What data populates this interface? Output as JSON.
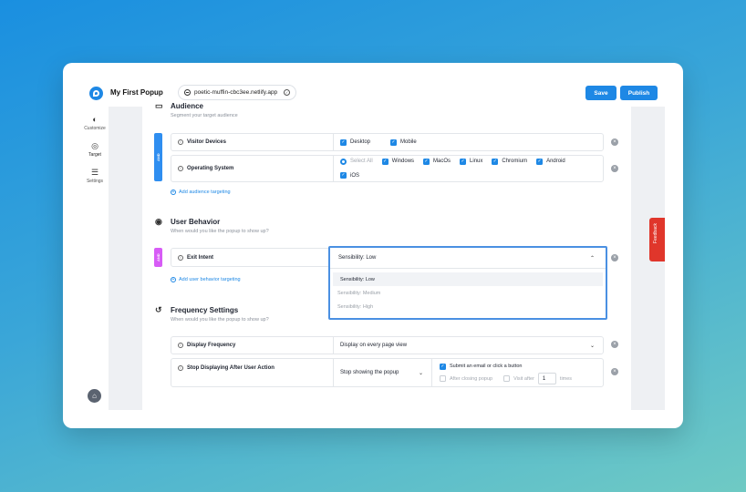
{
  "header": {
    "app_title": "My First Popup",
    "site_url": "poetic-muffin-cbc3ee.netlify.app",
    "save_label": "Save",
    "publish_label": "Publish"
  },
  "sidebar": {
    "items": [
      {
        "label": "Customize",
        "icon": "contrast-icon"
      },
      {
        "label": "Target",
        "icon": "target-icon"
      },
      {
        "label": "Settings",
        "icon": "sliders-icon"
      }
    ]
  },
  "audience": {
    "title": "Audience",
    "subtitle": "Segment your target audience",
    "tag": "AND",
    "visitor_devices": {
      "label": "Visitor Devices",
      "options": [
        {
          "label": "Desktop",
          "checked": true
        },
        {
          "label": "Mobile",
          "checked": true
        }
      ]
    },
    "operating_system": {
      "label": "Operating System",
      "select_all": "Select All",
      "options": [
        {
          "label": "Windows",
          "checked": true
        },
        {
          "label": "MacOs",
          "checked": true
        },
        {
          "label": "Linux",
          "checked": true
        },
        {
          "label": "Chromium",
          "checked": true
        },
        {
          "label": "Android",
          "checked": true
        },
        {
          "label": "iOS",
          "checked": true
        }
      ]
    },
    "add_link": "Add audience targeting"
  },
  "user_behavior": {
    "title": "User Behavior",
    "subtitle": "When would you like the popup to show up?",
    "tag": "AND",
    "exit_intent": {
      "label": "Exit Intent",
      "selected": "Sensibility: Low",
      "options": [
        "Sensibility: Low",
        "Sensibility: Medium",
        "Sensibility: High"
      ]
    },
    "add_link": "Add user behavior targeting"
  },
  "frequency": {
    "title": "Frequency Settings",
    "subtitle": "When would you like the popup to show up?",
    "display_frequency": {
      "label": "Display Frequency",
      "value": "Display on every page view"
    },
    "stop_displaying": {
      "label": "Stop Displaying After User Action",
      "value": "Stop showing the popup",
      "submit_label": "Submit an email or click a button",
      "after_closing_label": "After closing popup",
      "visit_after_label": "Visit after",
      "visit_after_value": "1",
      "times_label": "times"
    }
  },
  "feedback_label": "Feedback",
  "colors": {
    "accent": "#1e88e5",
    "and_tag_blue": "#2f8ef0",
    "and_tag_purple": "#d75cf6",
    "feedback": "#e0362b"
  }
}
